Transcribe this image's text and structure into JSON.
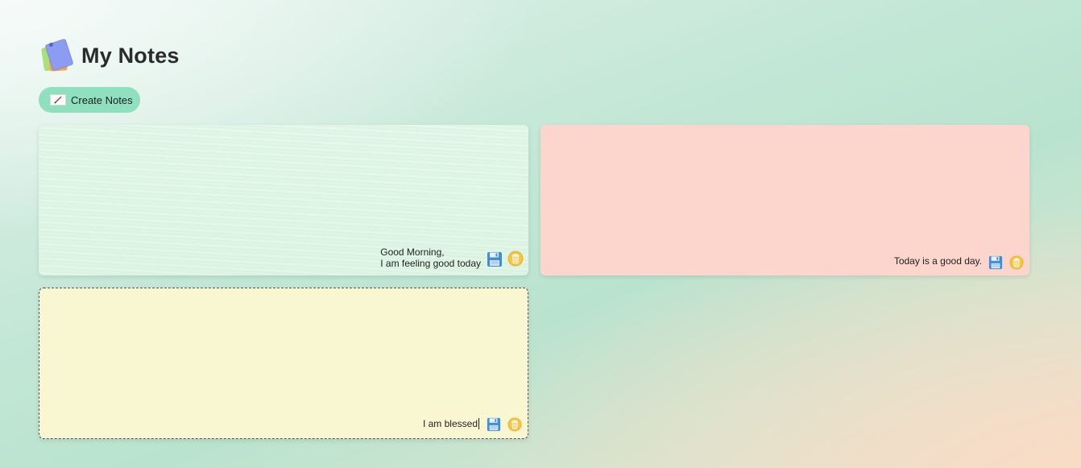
{
  "header": {
    "title": "My Notes",
    "logo_icon": "sticky-notes-icon"
  },
  "toolbar": {
    "create_label": "Create Notes",
    "create_icon": "pencil-icon"
  },
  "notes": [
    {
      "text": "Good Morning,\nI am feeling good today",
      "color": "#e2f5e6",
      "save_icon": "floppy-disk-icon",
      "delete_icon": "trash-icon"
    },
    {
      "text": "Today is a good day.",
      "color": "#fcd5cd",
      "save_icon": "floppy-disk-icon",
      "delete_icon": "trash-icon"
    },
    {
      "text": "I am blessed",
      "color": "#f9f7d1",
      "save_icon": "floppy-disk-icon",
      "delete_icon": "trash-icon",
      "focused": true
    }
  ],
  "colors": {
    "accent": "#8fe0bf",
    "save_blue": "#3f8fd8",
    "delete_yellow": "#f2b52a"
  }
}
